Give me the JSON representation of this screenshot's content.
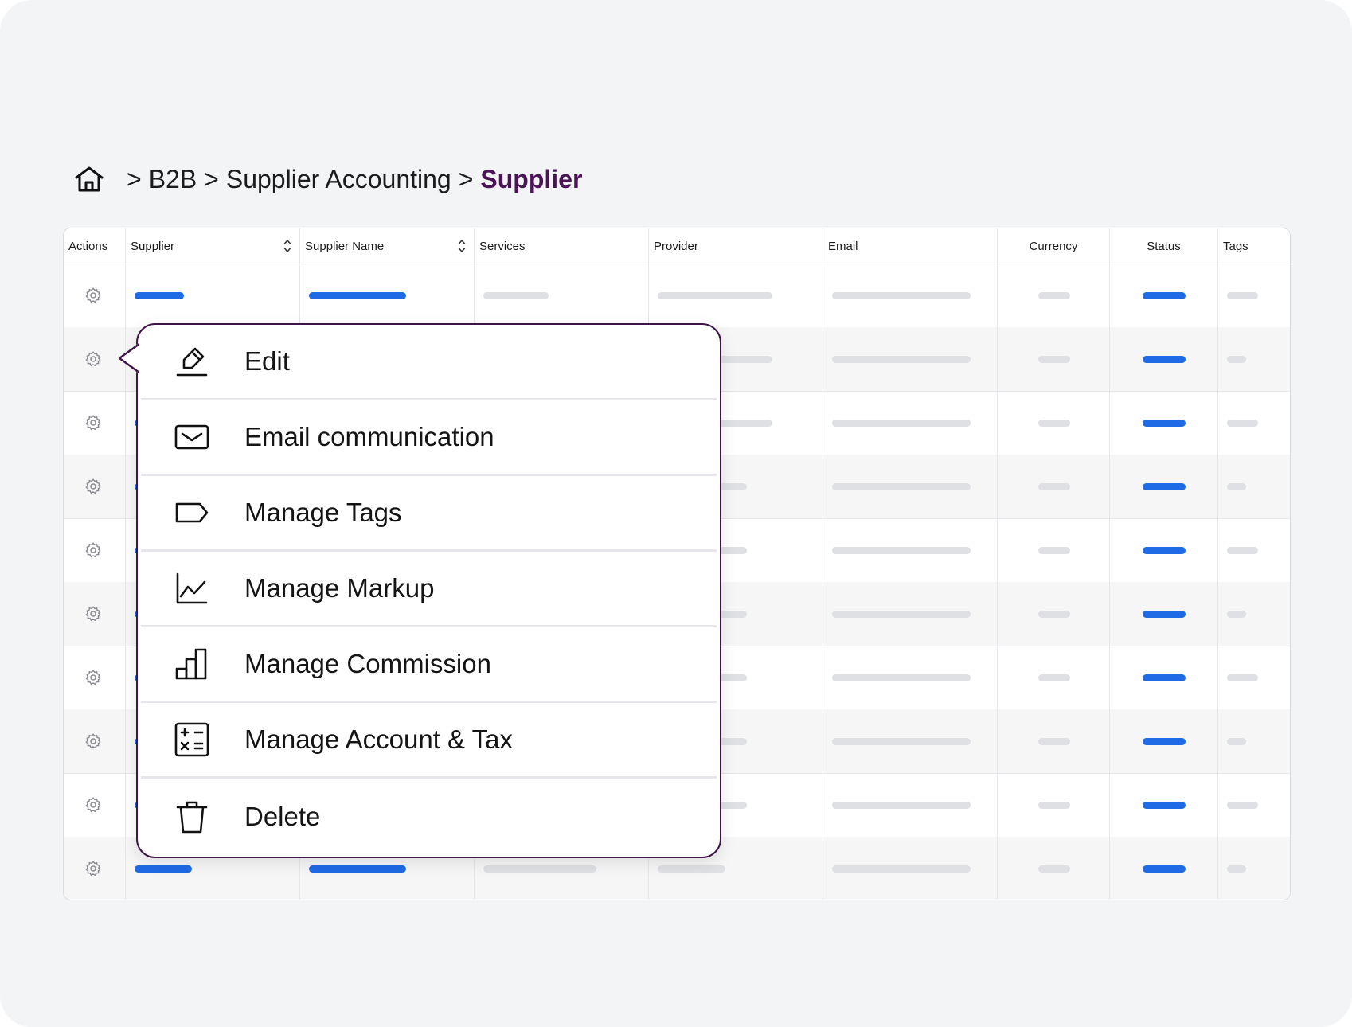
{
  "breadcrumb": {
    "home_icon": "home-icon",
    "separator": ">",
    "items": [
      "B2B",
      "Supplier Accounting"
    ],
    "current": "Supplier"
  },
  "table": {
    "columns": [
      {
        "label": "Actions",
        "sortable": false
      },
      {
        "label": "Supplier",
        "sortable": true
      },
      {
        "label": "Supplier Name",
        "sortable": true
      },
      {
        "label": "Services",
        "sortable": false
      },
      {
        "label": "Provider",
        "sortable": false
      },
      {
        "label": "Email",
        "sortable": false
      },
      {
        "label": "Currency",
        "sortable": false
      },
      {
        "label": "Status",
        "sortable": false
      },
      {
        "label": "Tags",
        "sortable": false
      }
    ],
    "row_count": 10,
    "row_action_icon": "gear-icon",
    "placeholder_colors": {
      "primary": "#1f6ae5",
      "muted": "#dfe0e3"
    }
  },
  "action_menu": {
    "items": [
      {
        "label": "Edit",
        "icon": "edit-icon"
      },
      {
        "label": "Email communication",
        "icon": "mail-icon"
      },
      {
        "label": "Manage Tags",
        "icon": "tag-icon"
      },
      {
        "label": "Manage Markup",
        "icon": "line-chart-icon"
      },
      {
        "label": "Manage Commission",
        "icon": "bar-chart-icon"
      },
      {
        "label": "Manage Account & Tax",
        "icon": "calculator-icon"
      },
      {
        "label": "Delete",
        "icon": "trash-icon"
      }
    ],
    "border_color": "#3e1449"
  }
}
